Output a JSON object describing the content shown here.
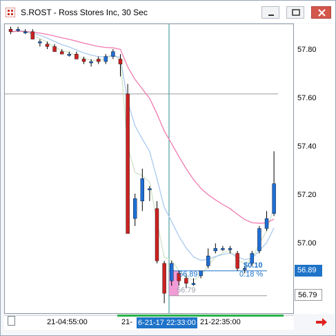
{
  "window": {
    "title": "S.ROST - Ross Stores Inc, 30 Sec"
  },
  "colors": {
    "bull": "#1f6fd6",
    "bear": "#cc2222",
    "ma_fast": "#cfe3c8",
    "ma_mid": "#a9c9ee",
    "ma_slow": "#f07ab0",
    "crosshair": "#2a8c8c",
    "accent": "#1f73c9",
    "close": "#d4574c"
  },
  "price_axis": {
    "ticks": [
      "57.80",
      "57.60",
      "57.40",
      "57.20",
      "57.00"
    ],
    "current_price": "56.89",
    "marker_price": "56.79"
  },
  "time_axis": {
    "labels": [
      "21-04:55:00",
      "21-",
      "21-22:35:00"
    ],
    "highlight": "6-21-17 22:33:00"
  },
  "measure": {
    "change": "$0.10",
    "percent": "0.18 %",
    "from_price": "56.89",
    "to_price": "56.79"
  },
  "chart_data": {
    "type": "candlestick",
    "title": "S.ROST - Ross Stores Inc, 30 Sec",
    "ylim": [
      56.72,
      57.88
    ],
    "candles": [
      {
        "o": 57.86,
        "h": 57.87,
        "l": 57.84,
        "c": 57.85
      },
      {
        "o": 57.86,
        "h": 57.87,
        "l": 57.85,
        "c": 57.86
      },
      {
        "o": 57.85,
        "h": 57.86,
        "l": 57.84,
        "c": 57.85
      },
      {
        "o": 57.85,
        "h": 57.86,
        "l": 57.82,
        "c": 57.82
      },
      {
        "o": 57.81,
        "h": 57.82,
        "l": 57.79,
        "c": 57.81
      },
      {
        "o": 57.8,
        "h": 57.81,
        "l": 57.78,
        "c": 57.79
      },
      {
        "o": 57.79,
        "h": 57.8,
        "l": 57.77,
        "c": 57.77
      },
      {
        "o": 57.77,
        "h": 57.78,
        "l": 57.76,
        "c": 57.76
      },
      {
        "o": 57.76,
        "h": 57.77,
        "l": 57.75,
        "c": 57.76
      },
      {
        "o": 57.76,
        "h": 57.77,
        "l": 57.74,
        "c": 57.74
      },
      {
        "o": 57.74,
        "h": 57.75,
        "l": 57.72,
        "c": 57.73
      },
      {
        "o": 57.73,
        "h": 57.74,
        "l": 57.71,
        "c": 57.73
      },
      {
        "o": 57.74,
        "h": 57.75,
        "l": 57.72,
        "c": 57.73
      },
      {
        "o": 57.73,
        "h": 57.76,
        "l": 57.72,
        "c": 57.75
      },
      {
        "o": 57.75,
        "h": 57.78,
        "l": 57.74,
        "c": 57.77
      },
      {
        "o": 57.74,
        "h": 57.76,
        "l": 57.67,
        "c": 57.72
      },
      {
        "o": 57.6,
        "h": 57.64,
        "l": 57.04,
        "c": 57.04
      },
      {
        "o": 57.1,
        "h": 57.2,
        "l": 57.07,
        "c": 57.18
      },
      {
        "o": 57.17,
        "h": 57.3,
        "l": 57.13,
        "c": 57.26
      },
      {
        "o": 57.22,
        "h": 57.23,
        "l": 57.17,
        "c": 57.22
      },
      {
        "o": 57.14,
        "h": 57.17,
        "l": 56.92,
        "c": 56.93
      },
      {
        "o": 56.92,
        "h": 56.93,
        "l": 56.76,
        "c": 56.8
      },
      {
        "o": 56.85,
        "h": 56.93,
        "l": 56.83,
        "c": 56.92
      },
      {
        "o": 56.88,
        "h": 56.89,
        "l": 56.83,
        "c": 56.85
      },
      {
        "o": 56.86,
        "h": 56.88,
        "l": 56.82,
        "c": 56.84
      },
      {
        "o": 56.84,
        "h": 56.86,
        "l": 56.83,
        "c": 56.84
      },
      {
        "o": 56.87,
        "h": 56.89,
        "l": 56.86,
        "c": 56.89
      },
      {
        "o": 56.91,
        "h": 56.98,
        "l": 56.9,
        "c": 56.95
      },
      {
        "o": 56.97,
        "h": 57.0,
        "l": 56.96,
        "c": 56.98
      },
      {
        "o": 56.98,
        "h": 56.99,
        "l": 56.97,
        "c": 56.98
      },
      {
        "o": 56.98,
        "h": 56.99,
        "l": 56.96,
        "c": 56.98
      },
      {
        "o": 56.96,
        "h": 56.97,
        "l": 56.89,
        "c": 56.9
      },
      {
        "o": 56.9,
        "h": 56.91,
        "l": 56.88,
        "c": 56.9
      },
      {
        "o": 56.92,
        "h": 56.97,
        "l": 56.91,
        "c": 56.96
      },
      {
        "o": 56.97,
        "h": 57.07,
        "l": 56.96,
        "c": 57.06
      },
      {
        "o": 57.06,
        "h": 57.13,
        "l": 57.05,
        "c": 57.1
      },
      {
        "o": 57.12,
        "h": 57.37,
        "l": 57.11,
        "c": 57.24
      }
    ]
  }
}
